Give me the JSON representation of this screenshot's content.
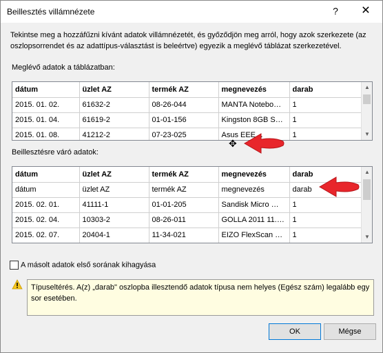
{
  "dialog": {
    "title": "Beillesztés villámnézete",
    "help_label": "?",
    "close_label": "✕"
  },
  "description": "Tekintse meg a hozzáfűzni kívánt adatok villámnézetét, és győződjön meg arról, hogy azok szerkezete (az oszlopsorrendet és az adattípus-választást is beleértve) egyezik a meglévő táblázat szerkezetével.",
  "existing": {
    "label": "Meglévő adatok a táblázatban:",
    "headers": [
      "dátum",
      "üzlet AZ",
      "termék AZ",
      "megnevezés",
      "darab"
    ],
    "rows": [
      [
        "2015. 01. 02.",
        "61632-2",
        "08-26-044",
        "MANTA Notebo…",
        "1"
      ],
      [
        "2015. 01. 04.",
        "61619-2",
        "01-01-156",
        "Kingston 8GB S…",
        "1"
      ],
      [
        "2015. 01. 08.",
        "41212-2",
        "07-23-025",
        "Asus EEE…",
        "1"
      ]
    ]
  },
  "paste": {
    "label": "Beillesztésre váró adatok:",
    "headers": [
      "dátum",
      "üzlet AZ",
      "termék AZ",
      "megnevezés",
      "darab"
    ],
    "rows": [
      [
        "dátum",
        "üzlet AZ",
        "termék AZ",
        "megnevezés",
        "darab"
      ],
      [
        "2015. 02. 01.",
        "41111-1",
        "01-01-205",
        "Sandisk Micro …",
        "1"
      ],
      [
        "2015. 02. 04.",
        "10303-2",
        "08-26-011",
        "GOLLA 2011 11.…",
        "1"
      ],
      [
        "2015. 02. 07.",
        "20404-1",
        "11-34-021",
        "EIZO FlexScan L…",
        "1"
      ]
    ]
  },
  "skip_first_row_label": "A másolt adatok első sorának kihagyása",
  "warning_text": "Típuseltérés. A(z) „darab\" oszlopba illesztendő adatok típusa nem helyes (Egész szám) legalább egy sor esetében.",
  "buttons": {
    "ok": "OK",
    "cancel": "Mégse"
  },
  "colors": {
    "arrow": "#e8262b",
    "warning_bg": "#fffde1",
    "warning_icon": "#f6c61c"
  }
}
